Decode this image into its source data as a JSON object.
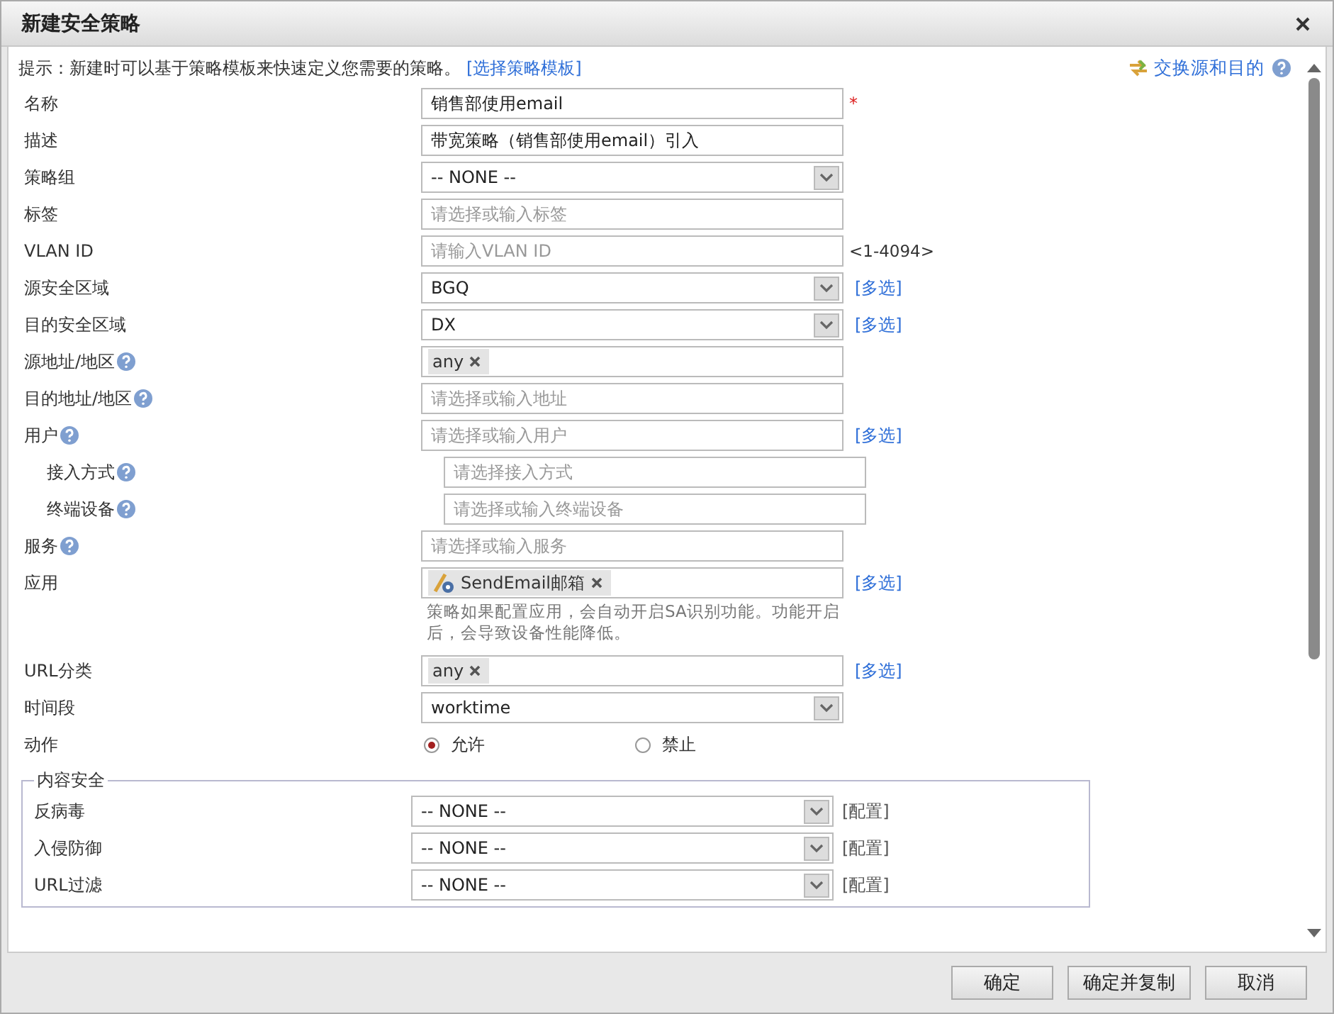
{
  "window": {
    "title": "新建安全策略"
  },
  "hint": {
    "text": "提示：新建时可以基于策略模板来快速定义您需要的策略。",
    "link": "[选择策略模板]",
    "swap_link": "交换源和目的"
  },
  "rows": [
    {
      "label": "名称",
      "kind": "text",
      "value": "销售部使用email",
      "required_mark": "*"
    },
    {
      "label": "描述",
      "kind": "text",
      "value": "带宽策略（销售部使用email）引入"
    },
    {
      "label": "策略组",
      "kind": "select",
      "value": "-- NONE --"
    },
    {
      "label": "标签",
      "kind": "text",
      "placeholder": "请选择或输入标签"
    },
    {
      "label": "VLAN ID",
      "kind": "text",
      "placeholder": "请输入VLAN ID",
      "suffix": "<1-4094>"
    },
    {
      "label": "源安全区域",
      "kind": "select",
      "value": "BGQ",
      "link": "[多选]"
    },
    {
      "label": "目的安全区域",
      "kind": "select",
      "value": "DX",
      "link": "[多选]"
    },
    {
      "label": "源地址/地区",
      "help": true,
      "kind": "tags",
      "tags": [
        {
          "text": "any",
          "app": false
        }
      ]
    },
    {
      "label": "目的地址/地区",
      "help": true,
      "kind": "text",
      "placeholder": "请选择或输入地址"
    },
    {
      "label": "用户",
      "help": true,
      "kind": "text",
      "placeholder": "请选择或输入用户",
      "link": "[多选]"
    },
    {
      "label": "接入方式",
      "help": true,
      "indent": true,
      "kind": "text",
      "placeholder": "请选择接入方式"
    },
    {
      "label": "终端设备",
      "help": true,
      "indent": true,
      "kind": "text",
      "placeholder": "请选择或输入终端设备"
    },
    {
      "label": "服务",
      "help": true,
      "kind": "text",
      "placeholder": "请选择或输入服务"
    },
    {
      "label": "应用",
      "kind": "tags",
      "tags": [
        {
          "text": "SendEmail邮箱",
          "app": true
        }
      ],
      "link": "[多选]",
      "note": "策略如果配置应用，会自动开启SA识别功能。功能开启后，会导致设备性能降低。"
    },
    {
      "label": "URL分类",
      "kind": "tags",
      "tags": [
        {
          "text": "any",
          "app": false
        }
      ],
      "link": "[多选]"
    },
    {
      "label": "时间段",
      "kind": "select",
      "value": "worktime"
    },
    {
      "label": "动作",
      "kind": "radio",
      "options": [
        {
          "label": "允许",
          "selected": true
        },
        {
          "label": "禁止",
          "selected": false
        }
      ]
    }
  ],
  "content_security": {
    "title": "内容安全",
    "rows": [
      {
        "label": "反病毒",
        "value": "-- NONE --",
        "link": "[配置]"
      },
      {
        "label": "入侵防御",
        "value": "-- NONE --",
        "link": "[配置]"
      },
      {
        "label": "URL过滤",
        "value": "-- NONE --",
        "link": "[配置]"
      }
    ]
  },
  "buttons": [
    "确定",
    "确定并复制",
    "取消"
  ]
}
